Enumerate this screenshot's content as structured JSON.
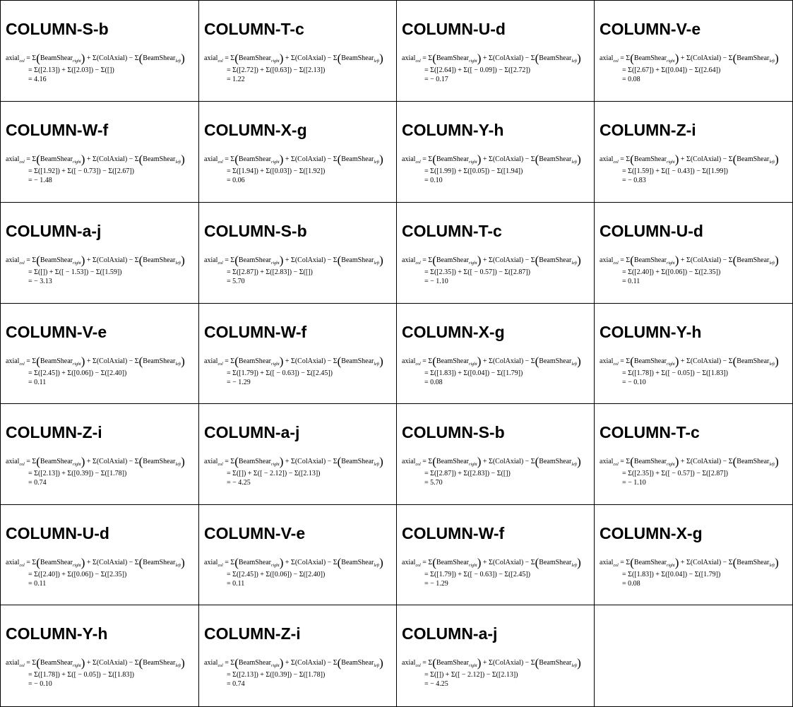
{
  "formula_label": "axial",
  "formula_label_sub": "col",
  "formula_terms": {
    "sigma": "Σ",
    "beam_shear": "BeamShear",
    "right_sub": "right",
    "left_sub": "left",
    "col_axial": "(ColAxial)",
    "plus": "+",
    "minus": "−",
    "equals": "="
  },
  "cells": [
    {
      "title": "COLUMN-S-b",
      "substitution": "Σ([2.13]) + Σ([2.03]) − Σ([])",
      "result": "4.16"
    },
    {
      "title": "COLUMN-T-c",
      "substitution": "Σ([2.72]) + Σ([0.63]) − Σ([2.13])",
      "result": "1.22"
    },
    {
      "title": "COLUMN-U-d",
      "substitution": "Σ([2.64]) + Σ([ − 0.09]) − Σ([2.72])",
      "result": " − 0.17"
    },
    {
      "title": "COLUMN-V-e",
      "substitution": "Σ([2.67]) + Σ([0.04]) − Σ([2.64])",
      "result": "0.08"
    },
    {
      "title": "COLUMN-W-f",
      "substitution": "Σ([1.92]) + Σ([ − 0.73]) − Σ([2.67])",
      "result": " − 1.48"
    },
    {
      "title": "COLUMN-X-g",
      "substitution": "Σ([1.94]) + Σ([0.03]) − Σ([1.92])",
      "result": "0.06"
    },
    {
      "title": "COLUMN-Y-h",
      "substitution": "Σ([1.99]) + Σ([0.05]) − Σ([1.94])",
      "result": "0.10"
    },
    {
      "title": "COLUMN-Z-i",
      "substitution": "Σ([1.59]) + Σ([ − 0.43]) − Σ([1.99])",
      "result": " − 0.83"
    },
    {
      "title": "COLUMN-a-j",
      "substitution": "Σ([]) + Σ([ − 1.53]) − Σ([1.59])",
      "result": " − 3.13"
    },
    {
      "title": "COLUMN-S-b",
      "substitution": "Σ([2.87]) + Σ([2.83]) − Σ([])",
      "result": "5.70"
    },
    {
      "title": "COLUMN-T-c",
      "substitution": "Σ([2.35]) + Σ([ − 0.57]) − Σ([2.87])",
      "result": " − 1.10"
    },
    {
      "title": "COLUMN-U-d",
      "substitution": "Σ([2.40]) + Σ([0.06]) − Σ([2.35])",
      "result": "0.11"
    },
    {
      "title": "COLUMN-V-e",
      "substitution": "Σ([2.45]) + Σ([0.06]) − Σ([2.40])",
      "result": "0.11"
    },
    {
      "title": "COLUMN-W-f",
      "substitution": "Σ([1.79]) + Σ([ − 0.63]) − Σ([2.45])",
      "result": " − 1.29"
    },
    {
      "title": "COLUMN-X-g",
      "substitution": "Σ([1.83]) + Σ([0.04]) − Σ([1.79])",
      "result": "0.08"
    },
    {
      "title": "COLUMN-Y-h",
      "substitution": "Σ([1.78]) + Σ([ − 0.05]) − Σ([1.83])",
      "result": " − 0.10"
    },
    {
      "title": "COLUMN-Z-i",
      "substitution": "Σ([2.13]) + Σ([0.39]) − Σ([1.78])",
      "result": "0.74"
    },
    {
      "title": "COLUMN-a-j",
      "substitution": "Σ([]) + Σ([ − 2.12]) − Σ([2.13])",
      "result": " − 4.25"
    },
    {
      "title": "COLUMN-S-b",
      "substitution": "Σ([2.87]) + Σ([2.83]) − Σ([])",
      "result": "5.70"
    },
    {
      "title": "COLUMN-T-c",
      "substitution": "Σ([2.35]) + Σ([ − 0.57]) − Σ([2.87])",
      "result": " − 1.10"
    },
    {
      "title": "COLUMN-U-d",
      "substitution": "Σ([2.40]) + Σ([0.06]) − Σ([2.35])",
      "result": "0.11"
    },
    {
      "title": "COLUMN-V-e",
      "substitution": "Σ([2.45]) + Σ([0.06]) − Σ([2.40])",
      "result": "0.11"
    },
    {
      "title": "COLUMN-W-f",
      "substitution": "Σ([1.79]) + Σ([ − 0.63]) − Σ([2.45])",
      "result": " − 1.29"
    },
    {
      "title": "COLUMN-X-g",
      "substitution": "Σ([1.83]) + Σ([0.04]) − Σ([1.79])",
      "result": "0.08"
    },
    {
      "title": "COLUMN-Y-h",
      "substitution": "Σ([1.78]) + Σ([ − 0.05]) − Σ([1.83])",
      "result": " − 0.10"
    },
    {
      "title": "COLUMN-Z-i",
      "substitution": "Σ([2.13]) + Σ([0.39]) − Σ([1.78])",
      "result": "0.74"
    },
    {
      "title": "COLUMN-a-j",
      "substitution": "Σ([]) + Σ([ − 2.12]) − Σ([2.13])",
      "result": " − 4.25"
    }
  ]
}
